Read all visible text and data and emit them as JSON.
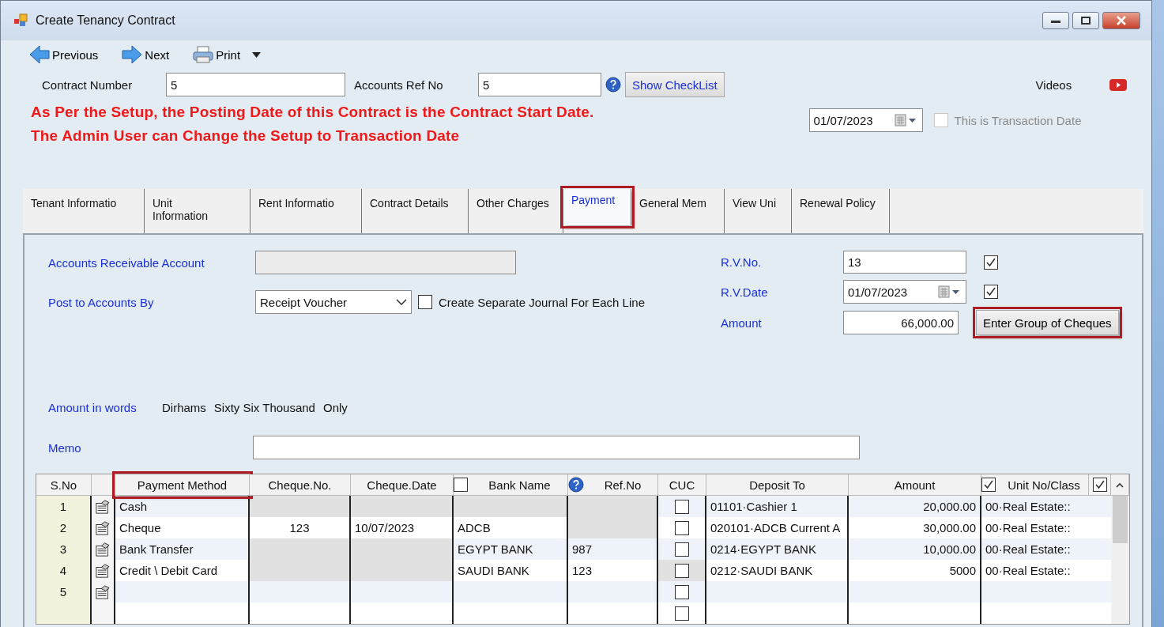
{
  "window": {
    "title": "Create Tenancy Contract"
  },
  "toolbar": [
    {
      "kind": "previous",
      "label": "Previous"
    },
    {
      "kind": "next",
      "label": "Next"
    },
    {
      "kind": "print",
      "label": "Print",
      "dropdown": true
    }
  ],
  "header": {
    "contract_number": {
      "label": "Contract Number",
      "value": "5"
    },
    "accounts_ref_no": {
      "label": "Accounts Ref No",
      "value": "5"
    },
    "checklist_button": "Show CheckList",
    "videos_label": "Videos"
  },
  "notices": [
    "As Per the Setup, the Posting Date of this Contract is the Contract Start Date.",
    "The Admin User can Change the Setup to Transaction Date"
  ],
  "posting_date": {
    "value": "01/07/2023",
    "transaction_date": {
      "label": "This is Transaction Date",
      "checked": false,
      "disabled": true
    }
  },
  "tabs": [
    {
      "label": "Tenant Informatio",
      "selected": false,
      "highlighted": false
    },
    {
      "label": "Unit Information",
      "selected": false,
      "highlighted": false
    },
    {
      "label": "Rent Informatio",
      "selected": false,
      "highlighted": false
    },
    {
      "label": "Contract Details",
      "selected": false,
      "highlighted": false
    },
    {
      "label": "Other Charges",
      "selected": false,
      "highlighted": false
    },
    {
      "label": "Payment",
      "selected": true,
      "highlighted": true
    },
    {
      "label": "General Mem",
      "selected": false,
      "highlighted": false
    },
    {
      "label": "View Uni",
      "selected": false,
      "highlighted": false
    },
    {
      "label": "Renewal Policy",
      "selected": false,
      "highlighted": false
    }
  ],
  "payment": {
    "ar_account": {
      "label": "Accounts Receivable Account",
      "disabled": true
    },
    "post_by": {
      "label": "Post to Accounts By",
      "value": "Receipt Voucher"
    },
    "separate_journal": {
      "label": "Create Separate Journal For Each Line",
      "checked": false
    },
    "rv_no": {
      "label": "R.V.No.",
      "value": "13",
      "checked": true
    },
    "rv_date": {
      "label": "R.V.Date",
      "value": "01/07/2023",
      "checked": true
    },
    "amount": {
      "label": "Amount",
      "value": "66,000.00"
    },
    "cheques_button": {
      "label": "Enter Group of Cheques",
      "highlighted": true
    },
    "amount_in_words": {
      "label": "Amount in words",
      "parts": [
        "Dirhams",
        "Sixty Six Thousand",
        "Only"
      ]
    },
    "memo": {
      "label": "Memo"
    }
  },
  "grid": {
    "columns": [
      {
        "kind": "index",
        "label": "S.No"
      },
      {
        "kind": "edit"
      },
      {
        "kind": "text",
        "label": "Payment Method",
        "highlighted": true
      },
      {
        "kind": "centered",
        "label": "Cheque.No."
      },
      {
        "kind": "text",
        "label": "Cheque.Date"
      },
      {
        "kind": "text",
        "label": "Bank Name",
        "header_checkbox": {
          "checked": false
        }
      },
      {
        "kind": "text",
        "label": "Ref.No",
        "help": true
      },
      {
        "kind": "checkbox",
        "label": "CUC"
      },
      {
        "kind": "text",
        "label": "Deposit To"
      },
      {
        "kind": "number",
        "label": "Amount"
      },
      {
        "kind": "text",
        "label": "Unit No/Class",
        "header_checkbox": {
          "checked": true
        }
      },
      {
        "kind": "blank",
        "header_checkbox": {
          "checked": true
        }
      }
    ],
    "rows": [
      {
        "cells": [
          {
            "text": "1"
          },
          {
            "edit_icon": true
          },
          {
            "text": "Cash"
          },
          {
            "disabled": true
          },
          {
            "disabled": true
          },
          {
            "disabled": true
          },
          {
            "disabled": true
          },
          {
            "checked": false
          },
          {
            "text": "01101·Cashier 1"
          },
          {
            "text": "20,000.00"
          },
          {
            "text": "00·Real Estate::"
          },
          {}
        ]
      },
      {
        "cells": [
          {
            "text": "2"
          },
          {
            "edit_icon": true
          },
          {
            "text": "Cheque"
          },
          {
            "text": "123"
          },
          {
            "text": "10/07/2023"
          },
          {
            "text": "ADCB"
          },
          {
            "disabled": true
          },
          {
            "checked": false
          },
          {
            "text": "020101·ADCB Current A"
          },
          {
            "text": "30,000.00"
          },
          {
            "text": "00·Real Estate::"
          },
          {}
        ]
      },
      {
        "cells": [
          {
            "text": "3"
          },
          {
            "edit_icon": true
          },
          {
            "text": "Bank Transfer"
          },
          {
            "disabled": true
          },
          {
            "disabled": true
          },
          {
            "text": "EGYPT BANK"
          },
          {
            "text": "987"
          },
          {
            "checked": false
          },
          {
            "text": "0214·EGYPT BANK"
          },
          {
            "text": "10,000.00"
          },
          {
            "text": "00·Real Estate::"
          },
          {}
        ]
      },
      {
        "cells": [
          {
            "text": "4"
          },
          {
            "edit_icon": true
          },
          {
            "text": "Credit \\ Debit Card"
          },
          {
            "disabled": true
          },
          {
            "disabled": true
          },
          {
            "text": "SAUDI BANK"
          },
          {
            "text": "123"
          },
          {
            "checked": false,
            "disabled": true
          },
          {
            "text": "0212·SAUDI BANK"
          },
          {
            "text": "5000"
          },
          {
            "text": "00·Real Estate::"
          },
          {}
        ]
      },
      {
        "cells": [
          {
            "text": "5"
          },
          {
            "edit_icon": true
          },
          {},
          {},
          {},
          {},
          {},
          {
            "checked": false
          },
          {},
          {},
          {},
          {}
        ]
      },
      {
        "cells": [
          {},
          {
            "edit_icon": false
          },
          {},
          {},
          {},
          {},
          {},
          {
            "checked": false
          },
          {},
          {},
          {},
          {}
        ]
      }
    ]
  }
}
